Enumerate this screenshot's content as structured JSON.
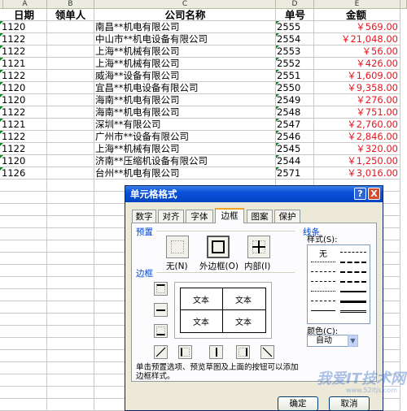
{
  "columns": [
    "A",
    "B",
    "C",
    "D",
    "E"
  ],
  "headers": {
    "date": "日期",
    "leader": "领单人",
    "company": "公司名称",
    "order_no": "单号",
    "amount": "金额"
  },
  "rows": [
    {
      "date": "1120",
      "company": "南昌**机电有限公司",
      "order_no": "2555",
      "amount": "￥569.00"
    },
    {
      "date": "1122",
      "company": "中山市**机电设备有限公司",
      "order_no": "2554",
      "amount": "￥21,048.00"
    },
    {
      "date": "1122",
      "company": "上海**机械有限公司",
      "order_no": "2553",
      "amount": "￥56.00"
    },
    {
      "date": "1121",
      "company": "上海**机械有限公司",
      "order_no": "2552",
      "amount": "￥426.00"
    },
    {
      "date": "1122",
      "company": "威海**设备有限公司",
      "order_no": "2551",
      "amount": "￥1,609.00"
    },
    {
      "date": "1120",
      "company": "宜昌**机电设备有限公司",
      "order_no": "2550",
      "amount": "￥9,358.00"
    },
    {
      "date": "1120",
      "company": "海南**机电有限公司",
      "order_no": "2549",
      "amount": "￥276.00"
    },
    {
      "date": "1122",
      "company": "海南**机电有限公司",
      "order_no": "2548",
      "amount": "￥751.00"
    },
    {
      "date": "1121",
      "company": "深圳**有限公司",
      "order_no": "2547",
      "amount": "￥2,760.00"
    },
    {
      "date": "1122",
      "company": "广州市**设备有限公司",
      "order_no": "2546",
      "amount": "￥2,846.00"
    },
    {
      "date": "1122",
      "company": "上海**机械有限公司",
      "order_no": "2545",
      "amount": "￥320.00"
    },
    {
      "date": "1120",
      "company": "济南**压缩机设备有限公司",
      "order_no": "2544",
      "amount": "￥1,250.00"
    },
    {
      "date": "1126",
      "company": "台州**机电有限公司",
      "order_no": "2571",
      "amount": "￥3,016.00"
    }
  ],
  "dialog": {
    "title": "单元格格式",
    "help": "?",
    "close": "X",
    "tabs": [
      "数字",
      "对齐",
      "字体",
      "边框",
      "图案",
      "保护"
    ],
    "active_tab": "边框",
    "presets_label": "预置",
    "preset_none": "无(N)",
    "preset_outline": "外边框(O)",
    "preset_inside": "内部(I)",
    "border_label": "边框",
    "preview_text": "文本",
    "line_label": "线条",
    "style_label": "样式(S):",
    "style_none": "无",
    "color_label": "颜色(C):",
    "color_value": "自动",
    "hint": "单击预置选项、预览草图及上面的按钮可以添加边框样式。",
    "ok": "确定",
    "cancel": "取消"
  },
  "watermark": {
    "main": "我爱IT技术网",
    "sub": "www.52itjs.com"
  }
}
